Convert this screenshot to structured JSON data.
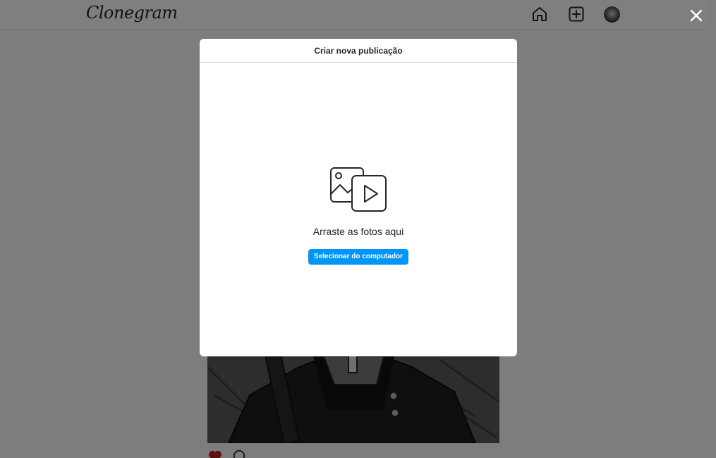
{
  "navbar": {
    "logo_text": "Clonegram",
    "home_icon": "home-icon",
    "add_icon": "add-post-icon",
    "avatar_icon": "profile-avatar"
  },
  "overlay": {
    "close_icon": "close-icon"
  },
  "modal": {
    "title": "Criar nova publicação",
    "media_icon": "photo-video-icon",
    "drag_text": "Arraste as fotos aqui",
    "select_button_label": "Selecionar do computador"
  },
  "colors": {
    "accent": "#0095f6",
    "text": "#262626",
    "overlay": "rgba(0,0,0,0.5)",
    "like": "#ed4956"
  }
}
